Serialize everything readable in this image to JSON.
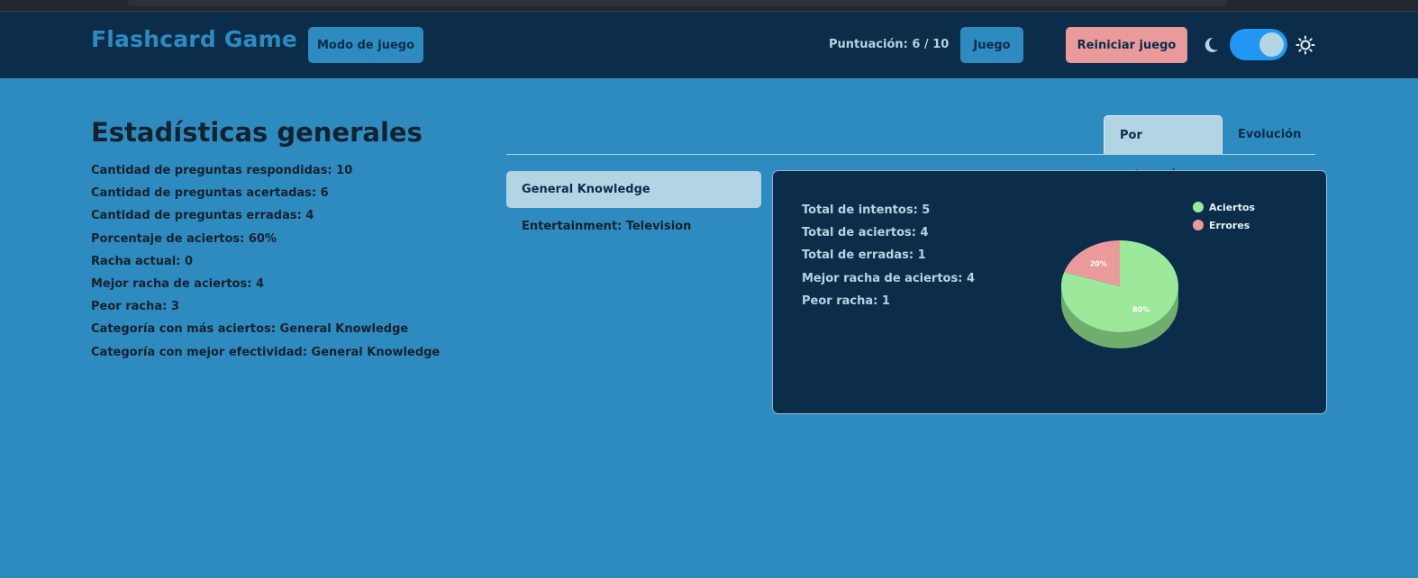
{
  "app": {
    "title": "Flashcard Game",
    "mode_button": "Modo de juego",
    "score_label": "Puntuación: 6 / 10",
    "game_button": "Juego",
    "reset_button": "Reiniciar juego",
    "theme_toggle": {
      "state": "on"
    },
    "icons": {
      "moon": "moon-icon",
      "sun": "sun-icon"
    }
  },
  "stats": {
    "title": "Estadísticas generales",
    "items": [
      "Cantidad de preguntas respondidas: 10",
      "Cantidad de preguntas acertadas: 6",
      "Cantidad de preguntas erradas: 4",
      "Porcentaje de aciertos: 60%",
      "Racha actual: 0",
      "Mejor racha de aciertos: 4",
      "Peor racha: 3",
      "Categoría con más aciertos: General Knowledge",
      "Categoría con mejor efectividad: General Knowledge"
    ]
  },
  "tabs": {
    "by_category": "Por categoría",
    "evolution": "Evolución",
    "active": "by_category"
  },
  "categories": {
    "items": [
      "General Knowledge",
      "Entertainment: Television"
    ],
    "selected": 0
  },
  "category_stats": {
    "items": [
      "Total de intentos: 5",
      "Total de aciertos: 4",
      "Total de erradas: 1",
      "Mejor racha de aciertos: 4",
      "Peor racha: 1"
    ]
  },
  "chart_data": {
    "type": "pie",
    "slices": [
      {
        "label": "Aciertos",
        "value": 80,
        "display": "80%",
        "color": "#9de99b",
        "shadow": "#6fae6c"
      },
      {
        "label": "Errores",
        "value": 20,
        "display": "20%",
        "color": "#ea9a9a",
        "shadow": "#b06f6f"
      }
    ],
    "legend": "top-right"
  },
  "colors": {
    "background": "#2e8bc0",
    "header": "#0b2d4a",
    "accent_light": "#b3d4e3",
    "reset": "#ea9a9a",
    "toggle": "#2196f3"
  }
}
